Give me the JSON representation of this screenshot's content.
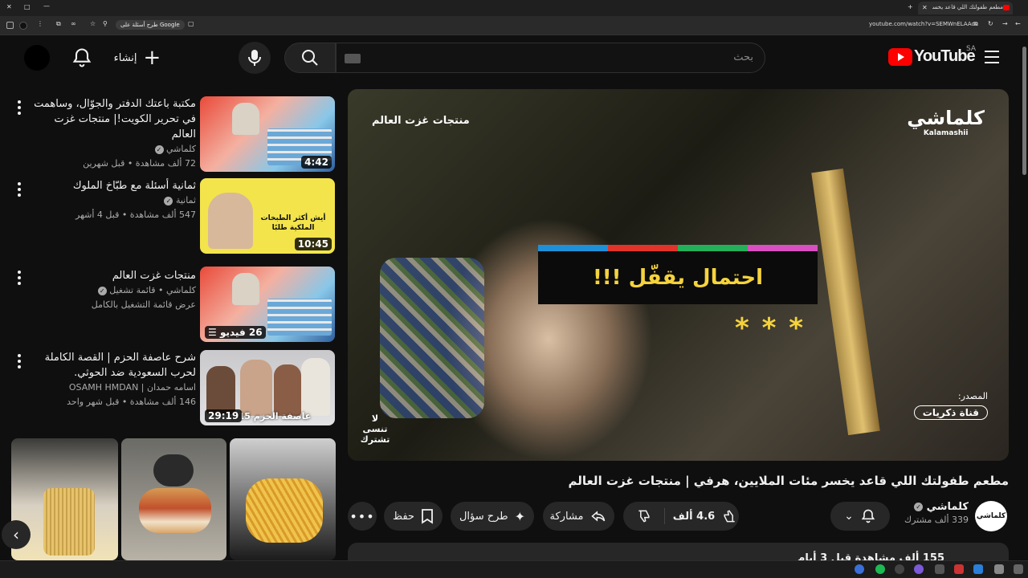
{
  "browser": {
    "tab_title": "مطعم طفولتك اللي قاعد يخسر",
    "address": "youtube.com/watch?v=SEMWnELAAcs",
    "google_chip": "طرح أسئلة على Google",
    "new_tab": "+"
  },
  "header": {
    "logo_text": "YouTube",
    "region": "SA",
    "search_placeholder": "بحث",
    "create_label": "إنشاء"
  },
  "sidebar": {
    "videos": [
      {
        "title": "مكتبة باعتك الدفتر والجوّال، وساهمت في تحرير الكويت!| منتجات غزت العالم",
        "channel": "كلماشي",
        "meta": "72 ألف مشاهدة • قبل شهرين",
        "duration": "4:42"
      },
      {
        "title": "ثمانية أسئلة مع طبّاخ الملوك",
        "channel": "ثمانية",
        "meta": "547 ألف مشاهدة • قبل 4 أشهر",
        "duration": "10:45",
        "thumb_caption": "أيش أكثر الطبخات الملكية طلبًا"
      },
      {
        "title": "منتجات غزت العالم",
        "channel": "كلماشي • قائمة تشغيل",
        "meta": "عرض قائمة التشغيل بالكامل",
        "duration": "26 فيديو"
      },
      {
        "title": "شرح عاصفة الحزم | القصة الكاملة لحرب السعودية ضد الحوثي.",
        "channel": "اسامه حمدان | OSAMH HMDAN",
        "meta": "146 ألف مشاهدة • قبل شهر واحد",
        "duration": "29:19",
        "thumb_caption": "عاصفة الحزم 015"
      }
    ]
  },
  "player": {
    "overlay_top": "منتجات غزت العالم",
    "brand": "كلماشي",
    "brand_en": "Kalamashii",
    "caption": "احتمال يقفّل !!!",
    "stars": "* * *",
    "source_label": "المصدر:",
    "source_name": "قناة ذكريات",
    "corner_text": "لا تنسى تشترك"
  },
  "video": {
    "title": "مطعم طفولتك اللي قاعد يخسر مئات الملايين، هرفي | منتجات غزت العالم",
    "channel_name": "كلماشي",
    "subscribers": "339 ألف مشترك",
    "likes": "4.6 ألف",
    "share_label": "مشاركة",
    "ask_label": "طرح سؤال",
    "save_label": "حفظ",
    "views_partial": "155 ألف مشاهدة قبل 3 أيام"
  },
  "colors": {
    "yt_red": "#ff0000",
    "bg": "#0f0f0f",
    "caption_yellow": "#f5d33d"
  }
}
